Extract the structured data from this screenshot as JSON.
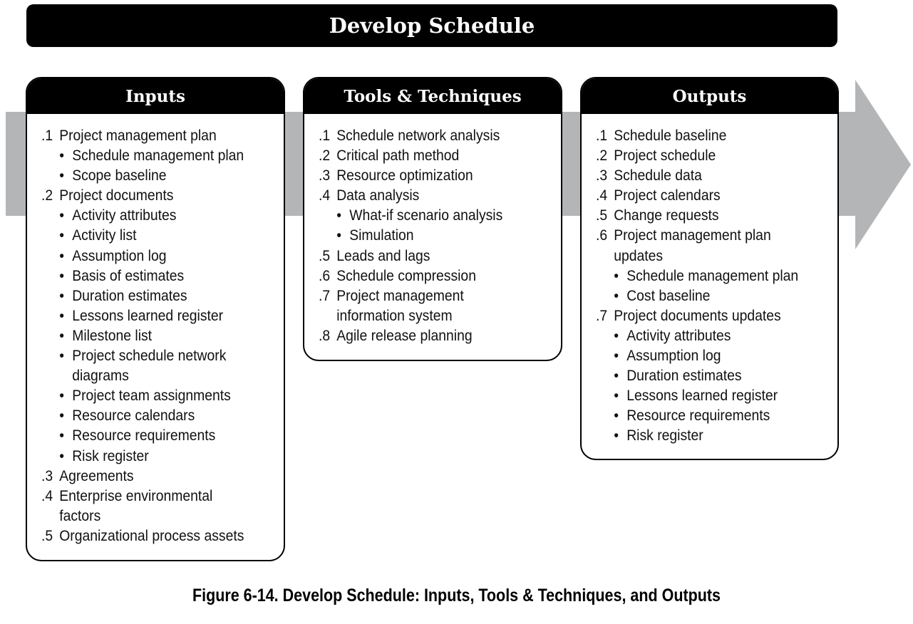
{
  "title": "Develop Schedule",
  "caption": "Figure 6-14. Develop Schedule: Inputs, Tools & Techniques, and Outputs",
  "colors": {
    "header_bg": "#000000",
    "arrow": "#b3b5b7"
  },
  "inputs": {
    "heading": "Inputs",
    "items": [
      {
        "num": ".1",
        "text": "Project management plan"
      },
      {
        "bullet": "•",
        "text": "Schedule management plan"
      },
      {
        "bullet": "•",
        "text": "Scope baseline"
      },
      {
        "num": ".2",
        "text": "Project documents"
      },
      {
        "bullet": "•",
        "text": "Activity attributes"
      },
      {
        "bullet": "•",
        "text": "Activity list"
      },
      {
        "bullet": "•",
        "text": "Assumption log"
      },
      {
        "bullet": "•",
        "text": "Basis of estimates"
      },
      {
        "bullet": "•",
        "text": "Duration estimates"
      },
      {
        "bullet": "•",
        "text": "Lessons learned register"
      },
      {
        "bullet": "•",
        "text": "Milestone list"
      },
      {
        "bullet": "•",
        "text": "Project schedule network"
      },
      {
        "bullet": "",
        "text": "diagrams"
      },
      {
        "bullet": "•",
        "text": "Project team assignments"
      },
      {
        "bullet": "•",
        "text": "Resource calendars"
      },
      {
        "bullet": "•",
        "text": "Resource requirements"
      },
      {
        "bullet": "•",
        "text": "Risk register"
      },
      {
        "num": ".3",
        "text": "Agreements"
      },
      {
        "num": ".4",
        "text": "Enterprise environmental"
      },
      {
        "num": "",
        "text": "factors"
      },
      {
        "num": ".5",
        "text": "Organizational process assets"
      }
    ]
  },
  "tools": {
    "heading": "Tools & Techniques",
    "items": [
      {
        "num": ".1",
        "text": "Schedule network analysis"
      },
      {
        "num": ".2",
        "text": "Critical path method"
      },
      {
        "num": ".3",
        "text": "Resource optimization"
      },
      {
        "num": ".4",
        "text": "Data analysis"
      },
      {
        "bullet": "•",
        "text": "What-if scenario analysis"
      },
      {
        "bullet": "•",
        "text": "Simulation"
      },
      {
        "num": ".5",
        "text": "Leads and lags"
      },
      {
        "num": ".6",
        "text": "Schedule compression"
      },
      {
        "num": ".7",
        "text": "Project management"
      },
      {
        "num": "",
        "text": "information system"
      },
      {
        "num": ".8",
        "text": "Agile release planning"
      }
    ]
  },
  "outputs": {
    "heading": "Outputs",
    "items": [
      {
        "num": ".1",
        "text": "Schedule baseline"
      },
      {
        "num": ".2",
        "text": "Project schedule"
      },
      {
        "num": ".3",
        "text": "Schedule data"
      },
      {
        "num": ".4",
        "text": "Project calendars"
      },
      {
        "num": ".5",
        "text": "Change requests"
      },
      {
        "num": ".6",
        "text": "Project management plan"
      },
      {
        "num": "",
        "text": "updates"
      },
      {
        "bullet": "•",
        "text": "Schedule management plan"
      },
      {
        "bullet": "•",
        "text": "Cost baseline"
      },
      {
        "num": ".7",
        "text": "Project documents updates"
      },
      {
        "bullet": "•",
        "text": "Activity attributes"
      },
      {
        "bullet": "•",
        "text": "Assumption log"
      },
      {
        "bullet": "•",
        "text": "Duration estimates"
      },
      {
        "bullet": "•",
        "text": "Lessons learned register"
      },
      {
        "bullet": "•",
        "text": "Resource requirements"
      },
      {
        "bullet": "•",
        "text": "Risk register"
      }
    ]
  }
}
